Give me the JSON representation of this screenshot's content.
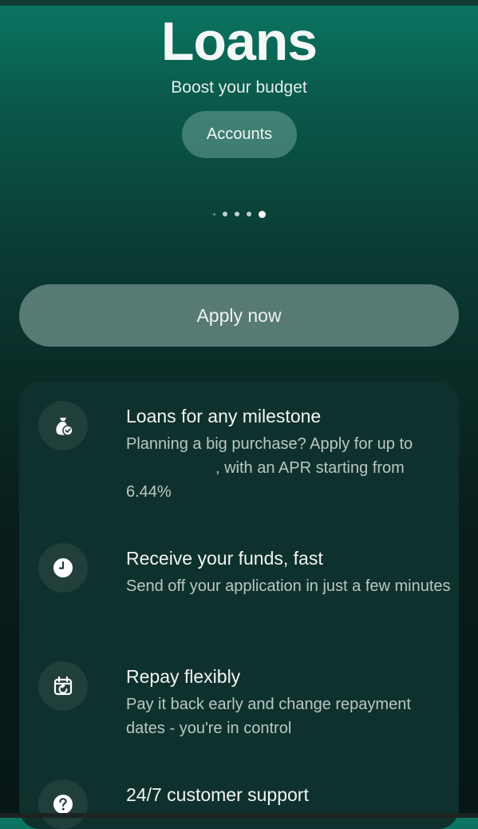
{
  "header": {
    "title": "Loans",
    "subtitle": "Boost your budget",
    "accounts_label": "Accounts"
  },
  "carousel": {
    "page_count": 5,
    "active_index": 4
  },
  "apply_label": "Apply now",
  "features": [
    {
      "icon": "money-bag-check-icon",
      "title": "Loans for any milestone",
      "desc_before": "Planning a big purchase? Apply for up to",
      "desc_after": ", with an APR starting from 6.44%"
    },
    {
      "icon": "clock-icon",
      "title": "Receive your funds, fast",
      "desc": "Send off your application in just a few minutes"
    },
    {
      "icon": "calendar-repeat-icon",
      "title": "Repay flexibly",
      "desc": "Pay it back early and change repayment dates - you're in control"
    },
    {
      "icon": "question-mark-icon",
      "title": "24/7 customer support"
    }
  ],
  "colors": {
    "gradient_top": "#0b7663",
    "gradient_bottom": "#071614",
    "button_bg": "#587a74",
    "card_bg": "#0f312d"
  }
}
